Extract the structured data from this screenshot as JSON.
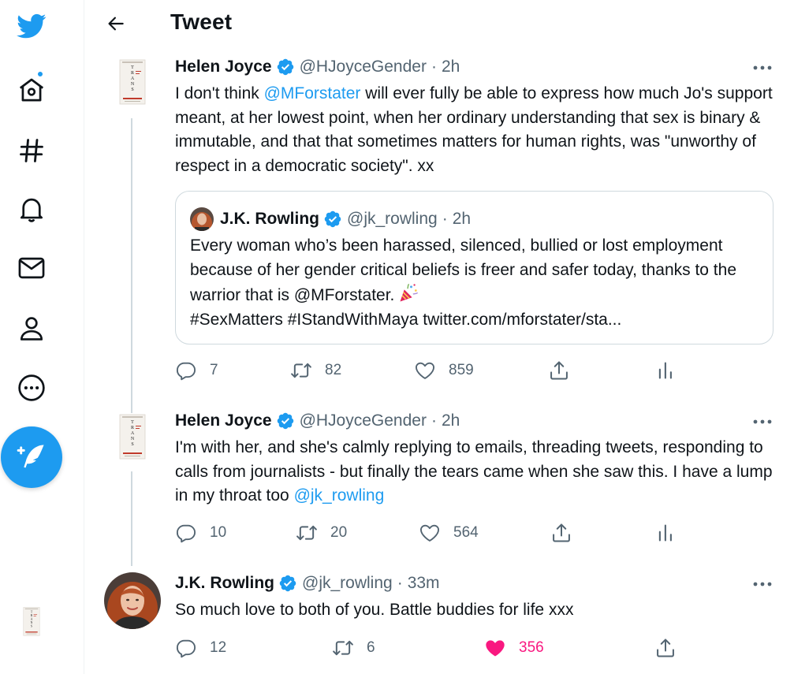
{
  "header": {
    "title": "Tweet",
    "back_icon": "arrow-left-icon"
  },
  "sidebar": {
    "items": [
      {
        "name": "twitter-logo-icon"
      },
      {
        "name": "home-icon",
        "has_notification_dot": true
      },
      {
        "name": "explore-hashtag-icon"
      },
      {
        "name": "notifications-bell-icon"
      },
      {
        "name": "messages-envelope-icon"
      },
      {
        "name": "profile-person-icon"
      },
      {
        "name": "more-circle-icon"
      }
    ],
    "compose_icon": "compose-feather-icon"
  },
  "tweets": [
    {
      "author": "Helen Joyce",
      "handle": "@HJoyceGender",
      "separator": "·",
      "time": "2h",
      "text_before": "I don't think ",
      "mention": "@MForstater",
      "text_after": " will ever fully be able to express how much Jo's support meant, at her lowest point, when her ordinary understanding that sex is binary & immutable, and that that sometimes matters for human rights, was \"unworthy of respect in a democratic society\". xx",
      "quote": {
        "author": "J.K. Rowling",
        "handle": "@jk_rowling",
        "separator": "·",
        "time": "2h",
        "text": "Every woman who’s been harassed, silenced, bullied or lost employment because of her gender critical beliefs is freer and safer today, thanks to the warrior that is @MForstater.",
        "emoji": "party-popper-icon",
        "text_line2": "#SexMatters #IStandWithMaya twitter.com/mforstater/sta..."
      },
      "replies": "7",
      "retweets": "82",
      "likes": "859"
    },
    {
      "author": "Helen Joyce",
      "handle": "@HJoyceGender",
      "separator": "·",
      "time": "2h",
      "text_before": "I'm with her, and she's calmly replying to emails, threading tweets, responding to calls from journalists - but finally the tears came when she saw this. I have a lump in my throat too ",
      "mention": "@jk_rowling",
      "replies": "10",
      "retweets": "20",
      "likes": "564"
    },
    {
      "author": "J.K. Rowling",
      "handle": "@jk_rowling",
      "separator": "·",
      "time": "33m",
      "text": "So much love to both of you. Battle buddies for life xxx",
      "replies": "12",
      "retweets": "6",
      "likes": "356",
      "liked": true
    }
  ],
  "colors": {
    "accent": "#1d9bf0",
    "like": "#f91880",
    "muted": "#536471",
    "text": "#0f1419"
  }
}
